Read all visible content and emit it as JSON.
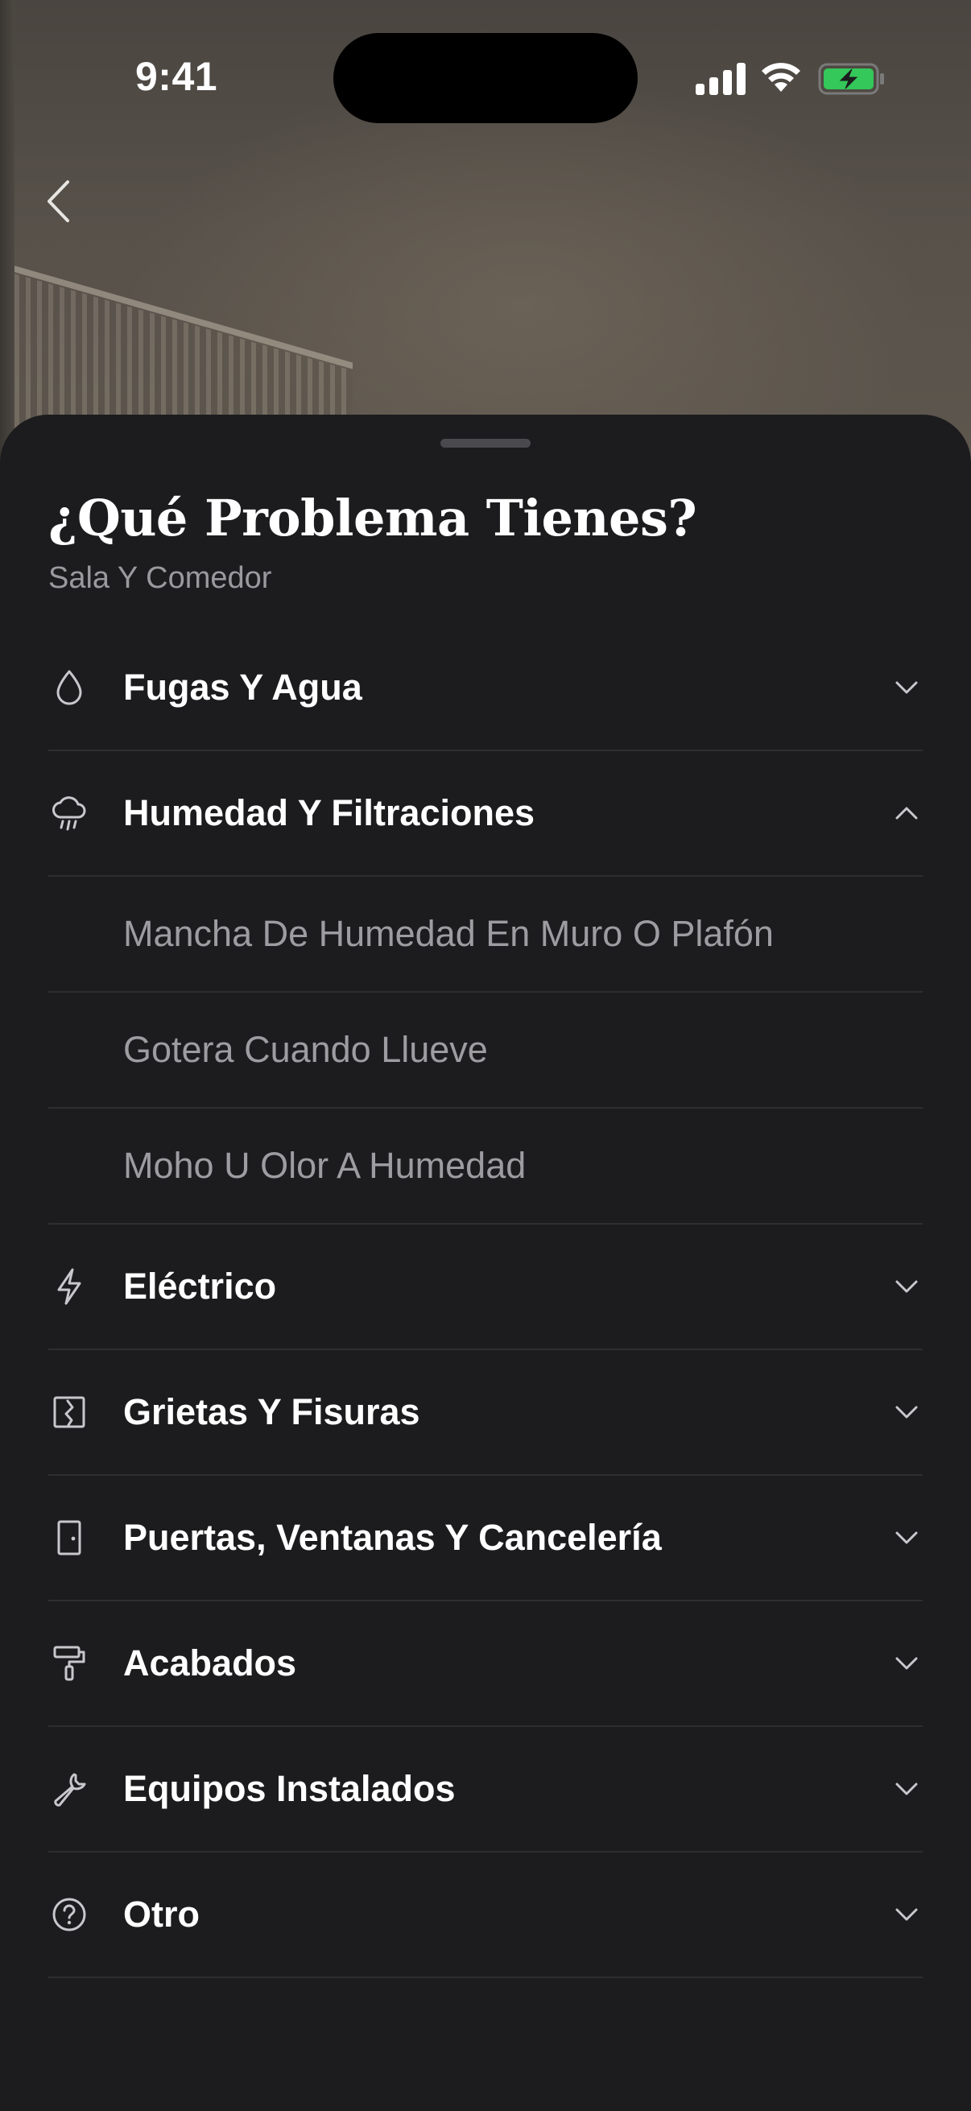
{
  "status_bar": {
    "time": "9:41"
  },
  "sheet": {
    "title": "¿Qué Problema Tienes?",
    "subtitle": "Sala Y Comedor"
  },
  "categories": [
    {
      "label": "Fugas Y Agua",
      "icon": "water-drop-icon",
      "expanded": false
    },
    {
      "label": "Humedad Y Filtraciones",
      "icon": "rain-cloud-icon",
      "expanded": true,
      "items": [
        "Mancha De Humedad En Muro O Plafón",
        "Gotera Cuando Llueve",
        "Moho U Olor A Humedad"
      ]
    },
    {
      "label": "Eléctrico",
      "icon": "lightning-icon",
      "expanded": false
    },
    {
      "label": "Grietas Y Fisuras",
      "icon": "crack-icon",
      "expanded": false
    },
    {
      "label": "Puertas, Ventanas Y Cancelería",
      "icon": "door-icon",
      "expanded": false
    },
    {
      "label": "Acabados",
      "icon": "paint-roller-icon",
      "expanded": false
    },
    {
      "label": "Equipos Instalados",
      "icon": "wrench-icon",
      "expanded": false
    },
    {
      "label": "Otro",
      "icon": "help-circle-icon",
      "expanded": false
    }
  ],
  "colors": {
    "sheet_background": "#1c1c1e",
    "divider": "#2e2e31",
    "secondary_text": "#9d9da1",
    "battery_green": "#34c759"
  }
}
